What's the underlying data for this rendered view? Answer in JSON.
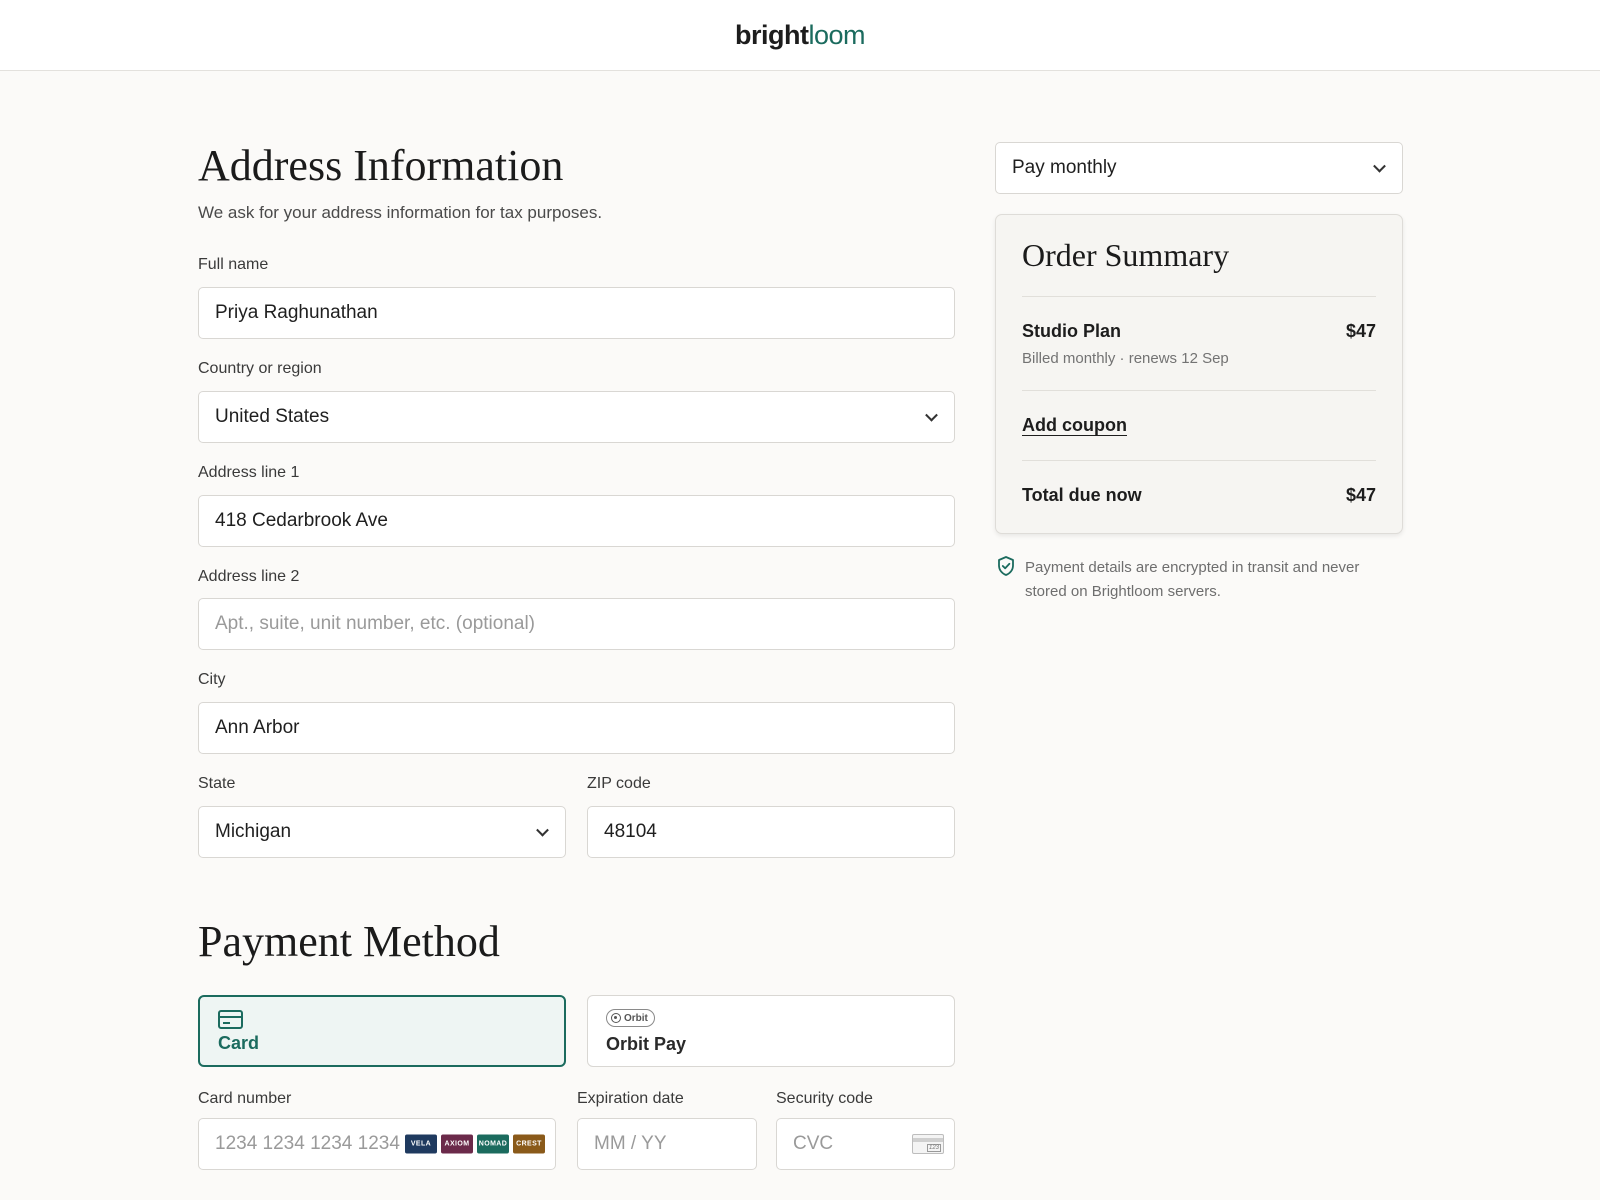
{
  "header": {
    "logo_bright": "bright",
    "logo_loom": "loom"
  },
  "address": {
    "title": "Address Information",
    "subtitle": "We ask for your address information for tax purposes.",
    "full_name": {
      "label": "Full name",
      "value": "Priya Raghunathan"
    },
    "country": {
      "label": "Country or region",
      "value": "United States"
    },
    "address1": {
      "label": "Address line 1",
      "value": "418 Cedarbrook Ave"
    },
    "address2": {
      "label": "Address line 2",
      "placeholder": "Apt., suite, unit number, etc. (optional)"
    },
    "city": {
      "label": "City",
      "value": "Ann Arbor"
    },
    "state": {
      "label": "State",
      "value": "Michigan"
    },
    "zip": {
      "label": "ZIP code",
      "value": "48104"
    }
  },
  "payment": {
    "title": "Payment Method",
    "methods": [
      {
        "label": "Card",
        "selected": true,
        "icon": "credit-card-icon"
      },
      {
        "label": "Orbit Pay",
        "selected": false,
        "badge": "Orbit"
      }
    ],
    "card_number": {
      "label": "Card number",
      "placeholder": "1234 1234 1234 1234"
    },
    "card_brands": [
      {
        "name": "VELA",
        "color": "#1f3a5f"
      },
      {
        "name": "AXIOM",
        "color": "#6b2a4a"
      },
      {
        "name": "NOMAD",
        "color": "#1b6b5e"
      },
      {
        "name": "CREST",
        "color": "#8a5a1a"
      }
    ],
    "expiry": {
      "label": "Expiration date",
      "placeholder": "MM / YY"
    },
    "cvc": {
      "label": "Security code",
      "placeholder": "CVC",
      "icon_text": "123"
    }
  },
  "sidebar": {
    "billing_select": "Pay monthly",
    "summary": {
      "title": "Order Summary",
      "plan_name": "Studio Plan",
      "plan_price": "$47",
      "plan_detail": "Billed monthly · renews 12 Sep",
      "coupon_link": "Add coupon",
      "total_label": "Total due now",
      "total_value": "$47"
    },
    "security_note": "Payment details are encrypted in transit and never stored on Brightloom servers."
  },
  "colors": {
    "accent": "#1b6b5e",
    "background": "#fbfaf8"
  }
}
